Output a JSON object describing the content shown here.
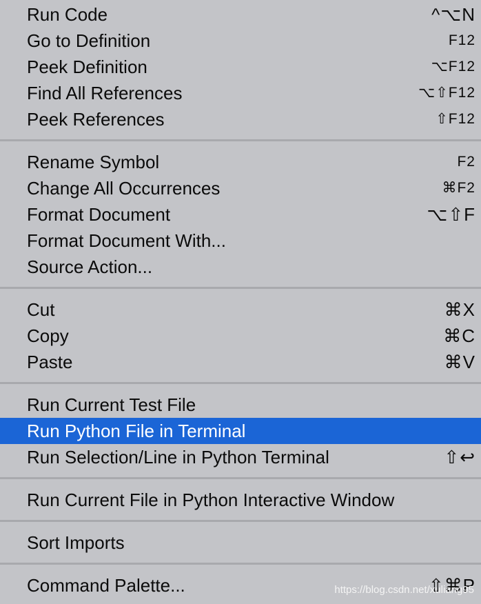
{
  "menu": {
    "groups": [
      {
        "items": [
          {
            "label": "Run Code",
            "shortcut": "^⌥N",
            "small": false
          },
          {
            "label": "Go to Definition",
            "shortcut": "F12",
            "small": true
          },
          {
            "label": "Peek Definition",
            "shortcut": "⌥F12",
            "small": true
          },
          {
            "label": "Find All References",
            "shortcut": "⌥⇧F12",
            "small": true
          },
          {
            "label": "Peek References",
            "shortcut": "⇧F12",
            "small": true
          }
        ]
      },
      {
        "items": [
          {
            "label": "Rename Symbol",
            "shortcut": "F2",
            "small": true
          },
          {
            "label": "Change All Occurrences",
            "shortcut": "⌘F2",
            "small": true
          },
          {
            "label": "Format Document",
            "shortcut": "⌥⇧F",
            "small": false
          },
          {
            "label": "Format Document With...",
            "shortcut": "",
            "small": false
          },
          {
            "label": "Source Action...",
            "shortcut": "",
            "small": false
          }
        ]
      },
      {
        "items": [
          {
            "label": "Cut",
            "shortcut": "⌘X",
            "small": false
          },
          {
            "label": "Copy",
            "shortcut": "⌘C",
            "small": false
          },
          {
            "label": "Paste",
            "shortcut": "⌘V",
            "small": false
          }
        ]
      },
      {
        "items": [
          {
            "label": "Run Current Test File",
            "shortcut": "",
            "small": false
          },
          {
            "label": "Run Python File in Terminal",
            "shortcut": "",
            "small": false,
            "highlighted": true
          },
          {
            "label": "Run Selection/Line in Python Terminal",
            "shortcut": "⇧↩",
            "small": false
          }
        ]
      },
      {
        "items": [
          {
            "label": "Run Current File in Python Interactive Window",
            "shortcut": "",
            "small": false
          }
        ]
      },
      {
        "items": [
          {
            "label": "Sort Imports",
            "shortcut": "",
            "small": false
          }
        ]
      },
      {
        "items": [
          {
            "label": "Command Palette...",
            "shortcut": "⇧⌘P",
            "small": false
          }
        ]
      }
    ]
  },
  "watermark": "https://blog.csdn.net/xuliang95",
  "colors": {
    "menu_background": "#c3c4c8",
    "highlight": "#1b65d6",
    "separator": "#a8a9ad"
  }
}
